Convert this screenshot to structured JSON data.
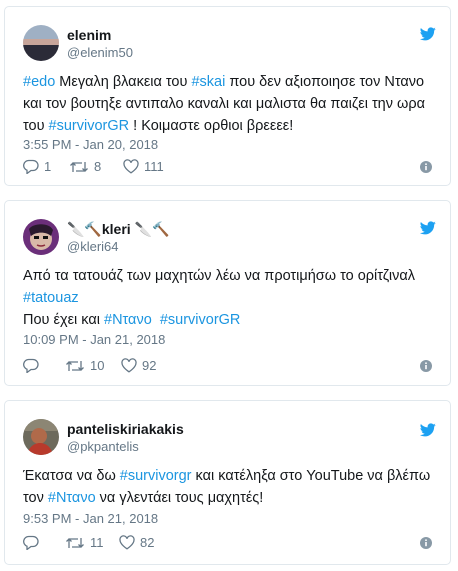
{
  "colors": {
    "link": "#1b95e0",
    "muted": "#657786",
    "bird": "#1da1f2",
    "border": "#e1e8ed"
  },
  "tweets": [
    {
      "name": "elenim",
      "handle": "@elenim50",
      "avatar_icon": "landscape-avatar",
      "line1": {
        "h1": "#edo",
        "t1": " Μεγαλη βλακεια του ",
        "h2": "#skai",
        "t2": " που δεν αξιοποιησε τον Ντανο"
      },
      "line2": {
        "t1": "και τον βουτηξε αντιπαλο καναλι και μαλιστα θα παιζει την ωρα"
      },
      "line3": {
        "t1": "του ",
        "h1": "#survivorGR",
        "t2": " ! Κοιμαστε ορθιοι βρεεεε!"
      },
      "time": "3:55 PM - Jan 20, 2018",
      "replies": "1",
      "retweets": "8",
      "likes": "111"
    },
    {
      "name_emoji": "🔪🔨",
      "name": "kleri",
      "name_emoji2": "🔪🔨",
      "handle": "@kleri64",
      "avatar_icon": "cartoon-avatar",
      "line1": {
        "t1": "Από τα τατουάζ των μαχητών λέω να προτιμήσω το ορίτζιναλ"
      },
      "line2": {
        "h1": "#tatouaz"
      },
      "line3": {
        "t1": "Που έχει και ",
        "h1": "#Ντανο",
        "t2": "  ",
        "h2": "#survivorGR"
      },
      "time": "10:09 PM - Jan 21, 2018",
      "replies": "",
      "retweets": "10",
      "likes": "92"
    },
    {
      "name": "panteliskiriakakis",
      "handle": "@pkpantelis",
      "avatar_icon": "photo-avatar",
      "line1": {
        "t1": "Έκατσα να δω ",
        "h1": "#survivorgr",
        "t2": " και κατέληξα στο YouTube να βλέπω"
      },
      "line2": {
        "t1": "τον ",
        "h1": "#Ντανο",
        "t2": " να γλεντάει τους μαχητές!"
      },
      "time": "9:53 PM - Jan 21, 2018",
      "replies": "",
      "retweets": "11",
      "likes": "82"
    }
  ]
}
